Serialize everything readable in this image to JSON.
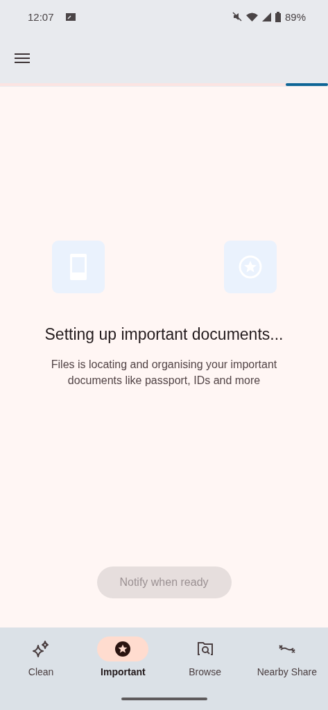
{
  "status_bar": {
    "time": "12:07",
    "battery": "89%"
  },
  "progress": {
    "level": 0.13
  },
  "title": "Setting up important documents...",
  "description": "Files is locating and organising your important documents like passport, IDs and more",
  "notify_button": {
    "label": "Notify when ready",
    "disabled": true
  },
  "bottom_nav": [
    {
      "label": "Clean",
      "selected": false
    },
    {
      "label": "Important",
      "selected": true
    },
    {
      "label": "Browse",
      "selected": false
    },
    {
      "label": "Nearby Share",
      "selected": false
    }
  ]
}
